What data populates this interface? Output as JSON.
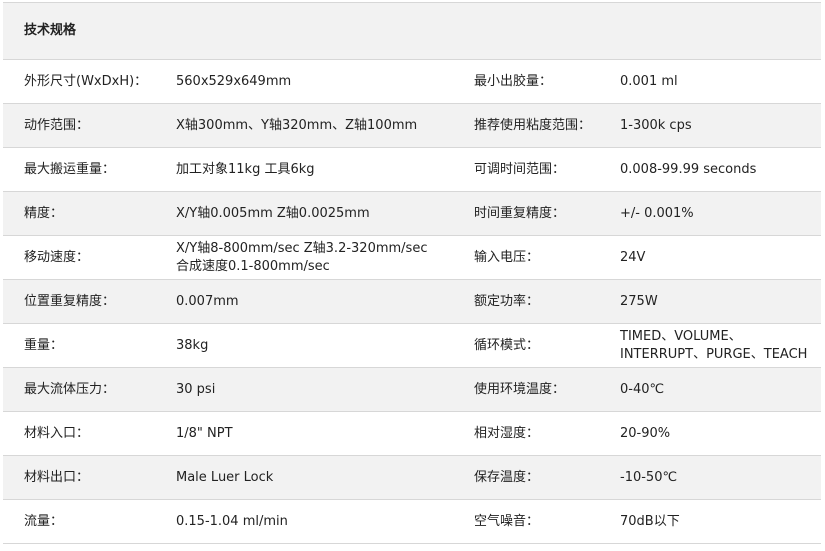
{
  "title": "技术规格",
  "rows": [
    {
      "l1": "外形尺寸(WxDxH)：",
      "v1": [
        "560x529x649mm"
      ],
      "l2": "最小出胶量：",
      "v2": [
        "0.001 ml"
      ]
    },
    {
      "l1": "动作范围：",
      "v1": [
        "X轴300mm、Y轴320mm、Z轴100mm"
      ],
      "l2": "推荐使用粘度范围：",
      "v2": [
        "1-300k cps"
      ]
    },
    {
      "l1": "最大搬运重量：",
      "v1": [
        "加工对象11kg  工具6kg"
      ],
      "l2": "可调时间范围：",
      "v2": [
        "0.008-99.99 seconds"
      ]
    },
    {
      "l1": "精度：",
      "v1": [
        "X/Y轴0.005mm  Z轴0.0025mm"
      ],
      "l2": "时间重复精度：",
      "v2": [
        "+/- 0.001%"
      ]
    },
    {
      "l1": "移动速度：",
      "v1": [
        "X/Y轴8-800mm/sec    Z轴3.2-320mm/sec",
        "合成速度0.1-800mm/sec"
      ],
      "l2": "输入电压：",
      "v2": [
        "24V"
      ]
    },
    {
      "l1": "位置重复精度：",
      "v1": [
        "0.007mm"
      ],
      "l2": "额定功率：",
      "v2": [
        "275W"
      ]
    },
    {
      "l1": "重量：",
      "v1": [
        "38kg"
      ],
      "l2": "循环模式：",
      "v2": [
        "TIMED、VOLUME、",
        "INTERRUPT、PURGE、TEACH"
      ]
    },
    {
      "l1": "最大流体压力：",
      "v1": [
        "30 psi"
      ],
      "l2": "使用环境温度：",
      "v2": [
        "0-40℃"
      ]
    },
    {
      "l1": "材料入口：",
      "v1": [
        "1/8\" NPT"
      ],
      "l2": "相对湿度：",
      "v2": [
        "20-90%"
      ]
    },
    {
      "l1": "材料出口：",
      "v1": [
        "Male Luer Lock"
      ],
      "l2": "保存温度：",
      "v2": [
        "-10-50℃"
      ]
    },
    {
      "l1": "流量：",
      "v1": [
        "0.15-1.04 ml/min"
      ],
      "l2": "空气噪音：",
      "v2": [
        "70dB以下"
      ]
    }
  ]
}
